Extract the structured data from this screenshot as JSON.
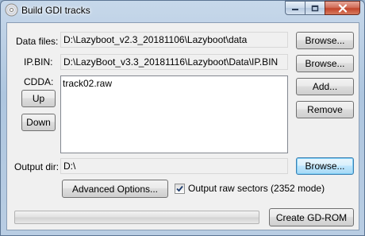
{
  "window": {
    "title": "Build GDI tracks",
    "icon": "cd-disc-icon",
    "caption": {
      "minimize_icon": "minimize-icon",
      "maximize_icon": "maximize-icon",
      "close_icon": "close-icon"
    }
  },
  "data_files": {
    "label": "Data files:",
    "value": "D:\\Lazyboot_v2.3_20181106\\Lazyboot\\data",
    "browse_label": "Browse..."
  },
  "ip_bin": {
    "label": "IP.BIN:",
    "value": "D:\\LazyBoot_v3.3_20181116\\Lazyboot\\Data\\IP.BIN",
    "browse_label": "Browse..."
  },
  "cdda": {
    "label": "CDDA:",
    "tracks": [
      "track02.raw"
    ],
    "up_label": "Up",
    "down_label": "Down",
    "add_label": "Add...",
    "remove_label": "Remove"
  },
  "output_dir": {
    "label": "Output dir:",
    "value": "D:\\",
    "browse_label": "Browse..."
  },
  "advanced_label": "Advanced Options...",
  "raw_sectors": {
    "label": "Output raw sectors (2352 mode)",
    "checked": true
  },
  "progress": {
    "value": 0
  },
  "create_label": "Create GD-ROM",
  "colors": {
    "progress_fill": "#06b025",
    "focus_border": "#3c7fb1",
    "close_red": "#c2452b"
  }
}
